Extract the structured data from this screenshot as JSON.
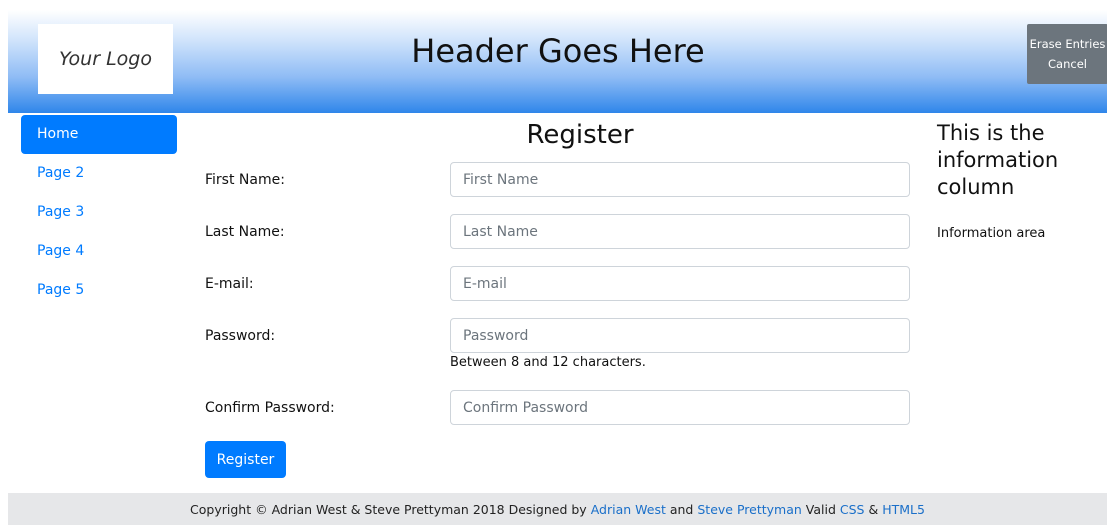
{
  "header": {
    "logo_text": "Your Logo",
    "title": "Header Goes Here",
    "erase_label": "Erase Entries",
    "cancel_label": "Cancel"
  },
  "sidebar": {
    "items": [
      {
        "label": "Home",
        "active": true
      },
      {
        "label": "Page 2"
      },
      {
        "label": "Page 3"
      },
      {
        "label": "Page 4"
      },
      {
        "label": "Page 5"
      }
    ]
  },
  "form": {
    "title": "Register",
    "fields": [
      {
        "label": "First Name:",
        "placeholder": "First Name",
        "value": ""
      },
      {
        "label": "Last Name:",
        "placeholder": "Last Name",
        "value": ""
      },
      {
        "label": "E-mail:",
        "placeholder": "E-mail",
        "value": ""
      },
      {
        "label": "Password:",
        "placeholder": "Password",
        "value": ""
      },
      {
        "label": "Confirm Password:",
        "placeholder": "Confirm Password",
        "value": ""
      }
    ],
    "password_help": "Between 8 and 12 characters.",
    "submit_label": "Register"
  },
  "info": {
    "title": "This is the information column",
    "text": "Information area"
  },
  "footer": {
    "prefix": "Copyright © Adrian West & Steve Prettyman 2018 Designed by",
    "link1": "Adrian West",
    "and": "and",
    "link2": "Steve Prettyman",
    "valid": "Valid",
    "css_link": "CSS",
    "amp": "&",
    "html5_link": "HTML5"
  },
  "colors": {
    "primary": "#007bff",
    "secondary": "#6c757d",
    "footer_bg": "#e6e7e9",
    "header_gradient_end": "#2f86ea"
  }
}
